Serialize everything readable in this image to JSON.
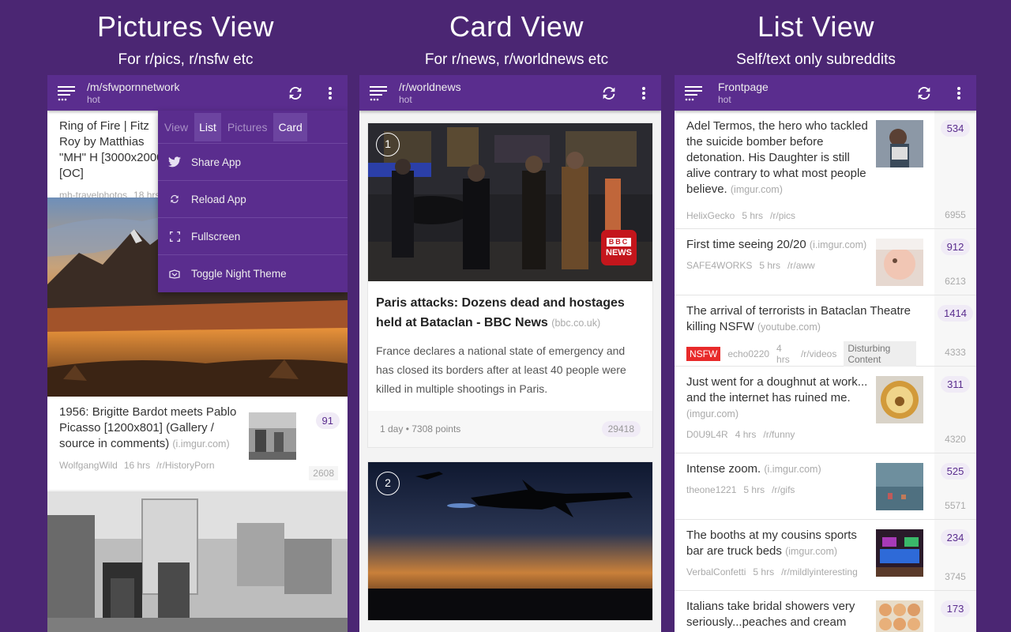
{
  "headings": [
    {
      "title": "Pictures View",
      "subtitle": "For r/pics, r/nsfw etc"
    },
    {
      "title": "Card View",
      "subtitle": "For r/news, r/worldnews etc"
    },
    {
      "title": "List View",
      "subtitle": "Self/text only subreddits"
    }
  ],
  "pictures": {
    "appbar": {
      "title": "/m/sfwpornnetwork",
      "sort": "hot"
    },
    "post1": {
      "title": "Ring of Fire | Fitz Roy by Matthias \"MH\" H [3000x2000] [OC]",
      "author": "mh-travelphotos",
      "time": "18 hrs"
    },
    "post2": {
      "title": "1956: Brigitte Bardot meets Pablo Picasso [1200x801] (Gallery / source in comments)",
      "domain": "(i.imgur.com)",
      "author": "WolfgangWild",
      "time": "16 hrs",
      "sub": "/r/HistoryPorn",
      "score": "91",
      "comments": "2608"
    },
    "menu": {
      "tabs": [
        "View",
        "List",
        "Pictures",
        "Card"
      ],
      "items": [
        "Share App",
        "Reload App",
        "Fullscreen",
        "Toggle Night Theme"
      ]
    }
  },
  "card": {
    "appbar": {
      "title": "/r/worldnews",
      "sort": "hot"
    },
    "card1": {
      "num": "1",
      "title": "Paris attacks: Dozens dead and hostages held at Bataclan - BBC News",
      "domain": "(bbc.co.uk)",
      "desc": "France declares a national state of emergency and has closed its borders after at least 40 people were killed in multiple shootings in Paris.",
      "age": "1 day",
      "points": "7308 points",
      "comments": "29418",
      "logo_top": "BBC",
      "logo_bottom": "NEWS"
    },
    "card2": {
      "num": "2"
    }
  },
  "list": {
    "appbar": {
      "title": "Frontpage",
      "sort": "hot"
    },
    "rows": [
      {
        "title": "Adel Termos, the hero who tackled the suicide bomber before detonation. His Daughter is still alive contrary to what most people believe.",
        "domain": "(imgur.com)",
        "author": "HelixGecko",
        "time": "5 hrs",
        "sub": "/r/pics",
        "score": "534",
        "comments": "6955"
      },
      {
        "title": "First time seeing 20/20",
        "domain": "(i.imgur.com)",
        "author": "SAFE4WORKS",
        "time": "5 hrs",
        "sub": "/r/aww",
        "score": "912",
        "comments": "6213"
      },
      {
        "title": "The arrival of terrorists in Bataclan Theatre killing NSFW",
        "domain": "(youtube.com)",
        "nsfw": "NSFW",
        "author": "echo0220",
        "time": "4 hrs",
        "sub": "/r/videos",
        "flair": "Disturbing Content",
        "score": "1414",
        "comments": "4333"
      },
      {
        "title": "Just went for a doughnut at work... and the internet has ruined me.",
        "domain": "(imgur.com)",
        "author": "D0U9L4R",
        "time": "4 hrs",
        "sub": "/r/funny",
        "score": "311",
        "comments": "4320"
      },
      {
        "title": "Intense zoom.",
        "domain": "(i.imgur.com)",
        "author": "theone1221",
        "time": "5 hrs",
        "sub": "/r/gifs",
        "score": "525",
        "comments": "5571"
      },
      {
        "title": "The booths at my cousins sports bar are truck beds",
        "domain": "(imgur.com)",
        "author": "VerbalConfetti",
        "time": "5 hrs",
        "sub": "/r/mildlyinteresting",
        "score": "234",
        "comments": "3745"
      },
      {
        "title": "Italians take bridal showers very seriously...peaches and cream",
        "score": "173"
      }
    ]
  },
  "colors": {
    "background": "#4b2673",
    "appbar": "#5a2d8e",
    "accent": "#5a2d8e",
    "nsfw": "#e82a2a"
  },
  "icons": [
    "menu-icon",
    "refresh-icon",
    "more-vert-icon",
    "twitter-icon",
    "reload-icon",
    "fullscreen-icon",
    "night-theme-icon"
  ]
}
